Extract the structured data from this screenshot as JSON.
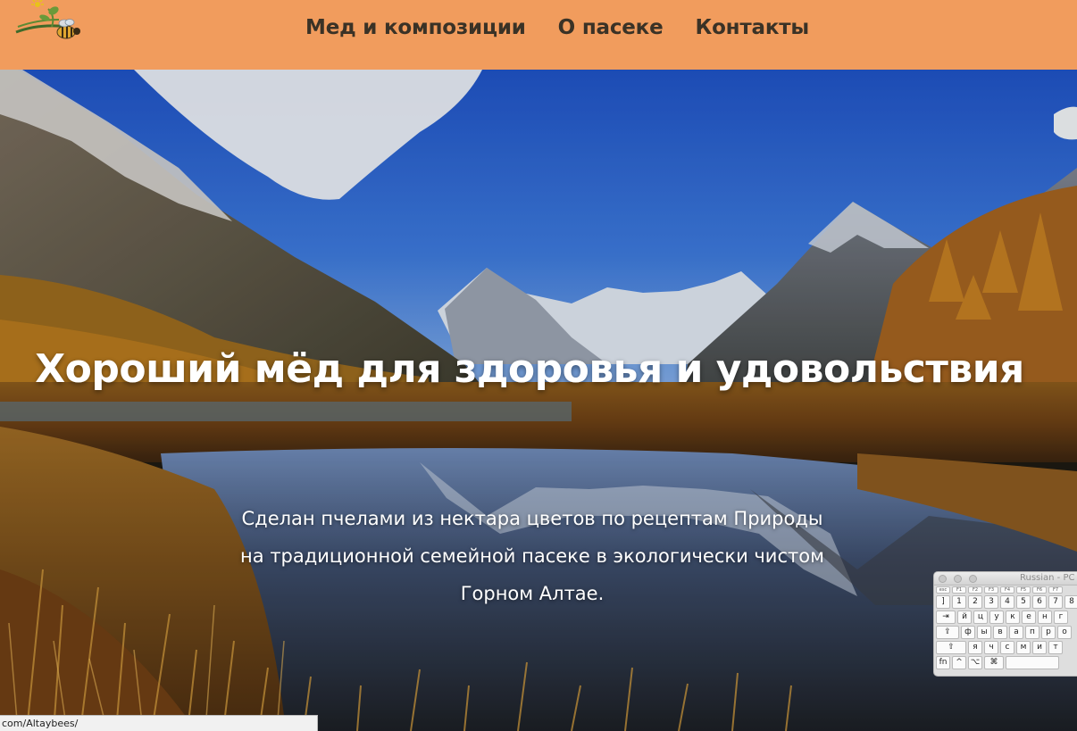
{
  "header": {
    "nav": [
      "Мед и композиции",
      "О пасеке",
      "Контакты"
    ],
    "background_color": "#f19c5d",
    "logo": "bee-logo-icon"
  },
  "hero": {
    "headline": "Хороший мёд для здоровья и удовольствия",
    "subtitle_lines": [
      "Сделан пчелами из нектара цветов по рецептам Природы",
      "на традиционной семейной пасеке в экологически чистом",
      "Горном Алтае."
    ],
    "background": "altai-mountain-lake-photo"
  },
  "statusbar": {
    "url": "com/Altaybees/"
  },
  "keyboard_viewer": {
    "title": "Russian - PC",
    "fn_keys": [
      "esc",
      "F1",
      "F2",
      "F3",
      "F4",
      "F5",
      "F6",
      "F7"
    ],
    "rows": [
      [
        "]",
        "1",
        "2",
        "3",
        "4",
        "5",
        "6",
        "7",
        "8"
      ],
      [
        "⇥",
        "й",
        "ц",
        "у",
        "к",
        "е",
        "н",
        "г"
      ],
      [
        "⇪",
        "ф",
        "ы",
        "в",
        "а",
        "п",
        "р",
        "о"
      ],
      [
        "⇧",
        "я",
        "ч",
        "с",
        "м",
        "и",
        "т"
      ],
      [
        "fn",
        "^",
        "⌥",
        "⌘"
      ]
    ]
  }
}
